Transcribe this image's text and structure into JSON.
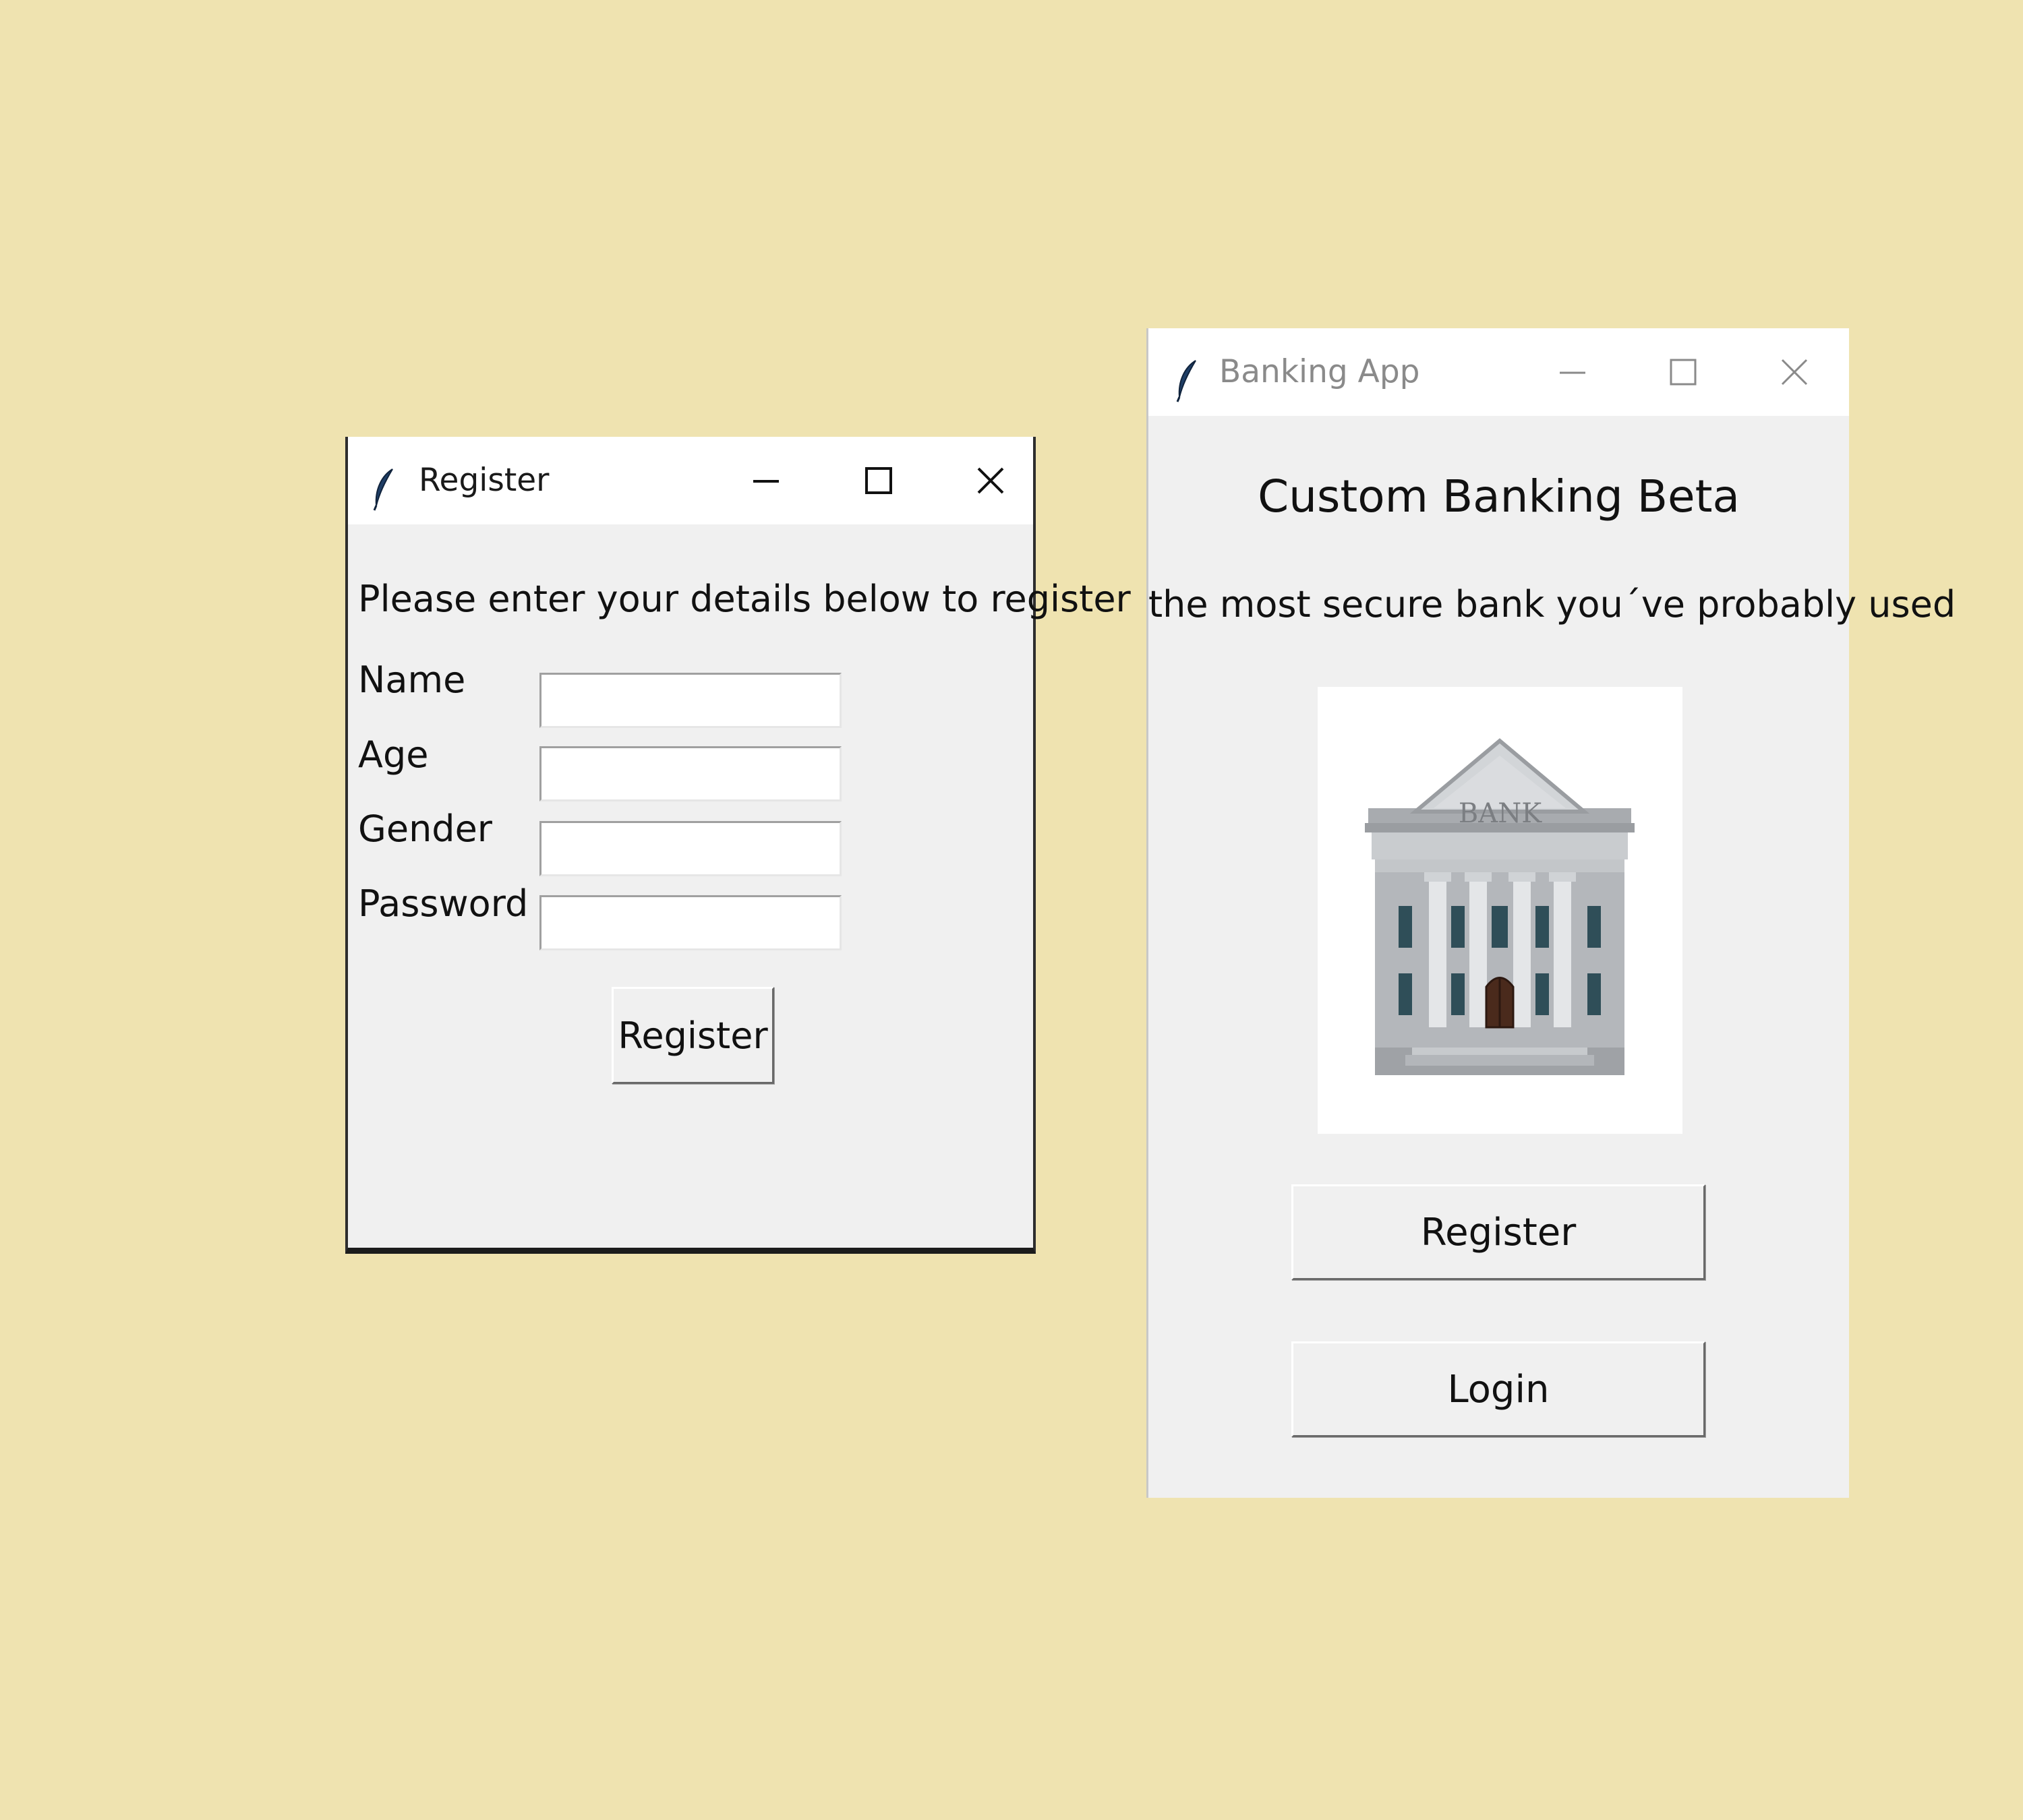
{
  "colors": {
    "desktop_background": "#EFE3B0",
    "window_background": "#F0F0F0",
    "titlebar_background": "#FFFFFF",
    "active_title_text": "#1A1A1A",
    "inactive_title_text": "#8A8A8A"
  },
  "register_window": {
    "title": "Register",
    "icon": "tk-feather-icon",
    "controls": {
      "minimize": "minimize-icon",
      "maximize": "maximize-icon",
      "close": "close-icon"
    },
    "intro": "Please enter your details below to register",
    "fields": [
      {
        "label": "Name",
        "value": ""
      },
      {
        "label": "Age",
        "value": ""
      },
      {
        "label": "Gender",
        "value": ""
      },
      {
        "label": "Password",
        "value": ""
      }
    ],
    "submit_label": "Register"
  },
  "banking_window": {
    "title": "Banking App",
    "icon": "tk-feather-icon",
    "controls": {
      "minimize": "minimize-icon",
      "maximize": "maximize-icon",
      "close": "close-icon"
    },
    "heading": "Custom Banking Beta",
    "tagline": "the most secure bank you´ve probably used",
    "logo_text": "BANK",
    "register_label": "Register",
    "login_label": "Login"
  }
}
